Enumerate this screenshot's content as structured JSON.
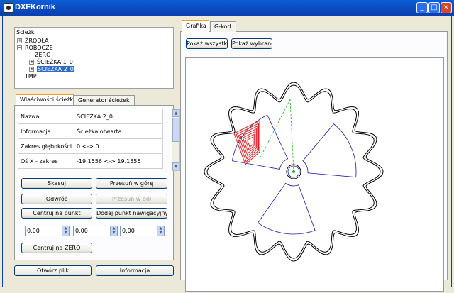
{
  "window": {
    "title": "DXFKornik"
  },
  "tree": {
    "header": "Ścieżki",
    "items": [
      {
        "label": "ŹRÓDŁA",
        "expander": "+"
      },
      {
        "label": "ROBOCZE",
        "expander": "−"
      },
      {
        "label": "ZERO",
        "expander": ""
      },
      {
        "label": "ŚCIEŻKA 1_0",
        "expander": "+"
      },
      {
        "label": "ŚCIEŻKA 2_0",
        "expander": "+"
      },
      {
        "label": "TMP",
        "expander": ""
      }
    ]
  },
  "left_tabs": [
    "Właściwości ścieżki",
    "Generator ścieżek"
  ],
  "properties": [
    {
      "key": "Nazwa",
      "value": "ŚCIEŻKA 2_0"
    },
    {
      "key": "Informacja",
      "value": "Ścieżka otwarta"
    },
    {
      "key": "Zakres głębokości",
      "value": "0 <-> 0"
    },
    {
      "key": "Oś X - zakres",
      "value": "-19.1556 <-> 19.1556"
    }
  ],
  "buttons": {
    "delete": "Skasuj",
    "move_up": "Przesuń w górę",
    "reverse": "Odwróć",
    "move_down": "Przesuń w dół",
    "center_on_point": "Centruj na punkt",
    "add_nav_point": "Dodaj punkt nawigacyjny",
    "center_on_zero": "Centruj na ZERO",
    "open_file": "Otwórz plik",
    "info": "Informacja"
  },
  "spinners": [
    "0,00",
    "0,00",
    "0,00"
  ],
  "right_tabs": [
    "Grafika",
    "G-kod"
  ],
  "view_buttons": {
    "show_all": "Pokaż wszystko",
    "show_selected": "Pokaż wybrane"
  },
  "colors": {
    "gear": "#000000",
    "sectors": "#1a1aa0",
    "toolpath": "#e02020",
    "nav": "#20b020"
  }
}
